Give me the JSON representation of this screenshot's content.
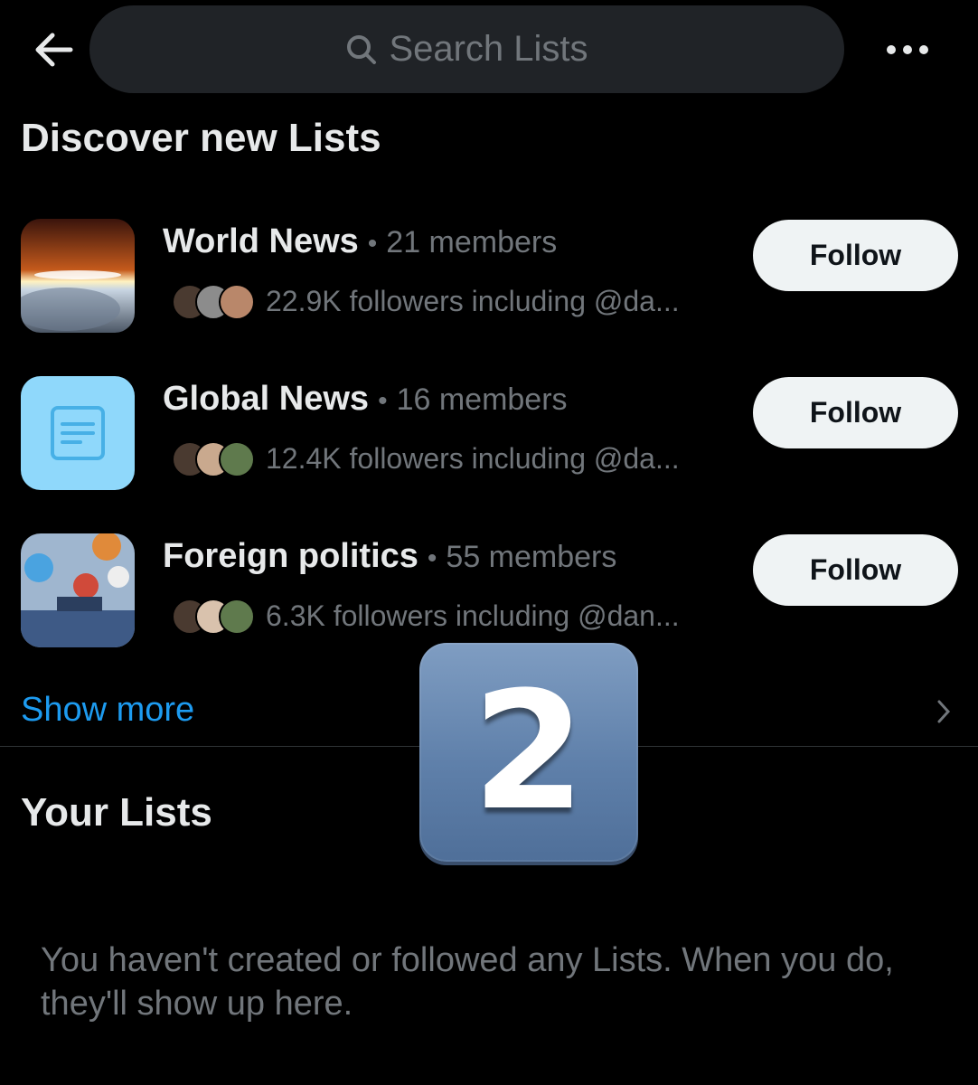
{
  "header": {
    "back_icon": "arrow-left-icon",
    "search_placeholder": "Search Lists",
    "more_icon": "more-horizontal-icon"
  },
  "discover": {
    "title": "Discover new Lists",
    "lists": [
      {
        "name": "World News",
        "separator": "•",
        "members": "21 members",
        "followers": "22.9K followers including @da...",
        "follow_label": "Follow"
      },
      {
        "name": "Global News",
        "separator": "•",
        "members": "16 members",
        "followers": "12.4K followers including @da...",
        "follow_label": "Follow"
      },
      {
        "name": "Foreign politics",
        "separator": "•",
        "members": "55 members",
        "followers": "6.3K followers including @dan...",
        "follow_label": "Follow"
      }
    ],
    "show_more": "Show more"
  },
  "your_lists": {
    "title": "Your Lists",
    "empty_message": "You haven't created or followed any Lists. When you do, they'll show up here."
  },
  "overlay_badge": "2",
  "colors": {
    "background": "#000000",
    "link": "#1d9bf0",
    "muted": "#71767b",
    "button_bg": "#eff3f4"
  }
}
